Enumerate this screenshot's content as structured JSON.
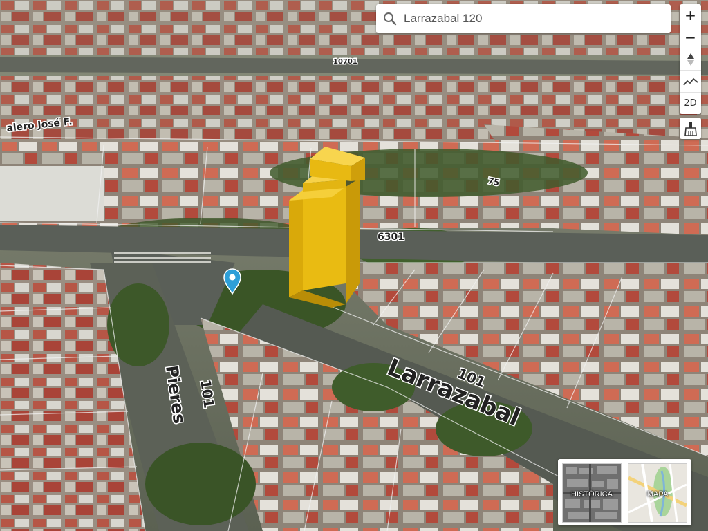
{
  "search": {
    "value": "Larrazabal 120",
    "placeholder": ""
  },
  "toolbar": {
    "zoom_in": "+",
    "zoom_out": "−",
    "mode_2d": "2D"
  },
  "streets": {
    "larrazabal": "Larrazabal",
    "larrazabal_num": "101",
    "pieres": "Pieres",
    "pieres_num": "101",
    "cross_num": "6301",
    "top_num": "10701",
    "right_num": "75",
    "diag_label": "alero José F."
  },
  "basemaps": [
    {
      "label": "HISTÓRICA"
    },
    {
      "label": "MAPA"
    }
  ],
  "colors": {
    "building": "#e8b911",
    "pin": "#2e9fd8",
    "road": "#5a5f58"
  },
  "icons": [
    "search-icon",
    "zoom-in-icon",
    "zoom-out-icon",
    "compass-icon",
    "profile-icon",
    "broom-icon",
    "location-pin-icon"
  ]
}
